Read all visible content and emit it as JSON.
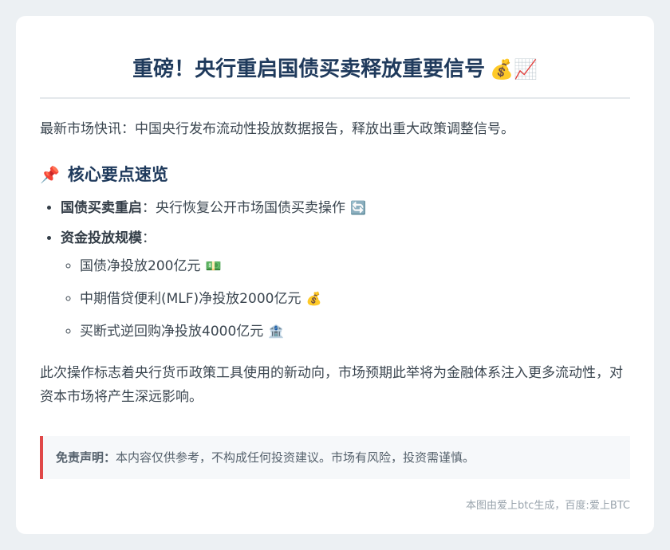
{
  "header": {
    "title": "重磅！央行重启国债买卖释放重要信号",
    "title_emoji": "💰📈"
  },
  "intro": "最新市场快讯：中国央行发布流动性投放数据报告，释放出重大政策调整信号。",
  "section": {
    "emoji": "📌",
    "title": "核心要点速览"
  },
  "points": [
    {
      "label": "国债买卖重启",
      "colon": "：",
      "text": "央行恢复公开市场国债买卖操作",
      "emoji": "🔄"
    },
    {
      "label": "资金投放规模",
      "colon": "："
    }
  ],
  "sub_points": [
    {
      "text": "国债净投放200亿元",
      "emoji": "💵"
    },
    {
      "text": "中期借贷便利(MLF)净投放2000亿元",
      "emoji": "💰"
    },
    {
      "text": "买断式逆回购净投放4000亿元",
      "emoji": "🏦"
    }
  ],
  "conclusion": "此次操作标志着央行货币政策工具使用的新动向，市场预期此举将为金融体系注入更多流动性，对资本市场将产生深远影响。",
  "disclaimer": {
    "label": "免责声明：",
    "text": "本内容仅供参考，不构成任何投资建议。市场有风险，投资需谨慎。"
  },
  "footer": "本图由爱上btc生成，百度:爱上BTC",
  "colors": {
    "page_background": "#ecf0f3",
    "title": "#1f3a5c",
    "disclaimer_accent": "#e04848"
  }
}
